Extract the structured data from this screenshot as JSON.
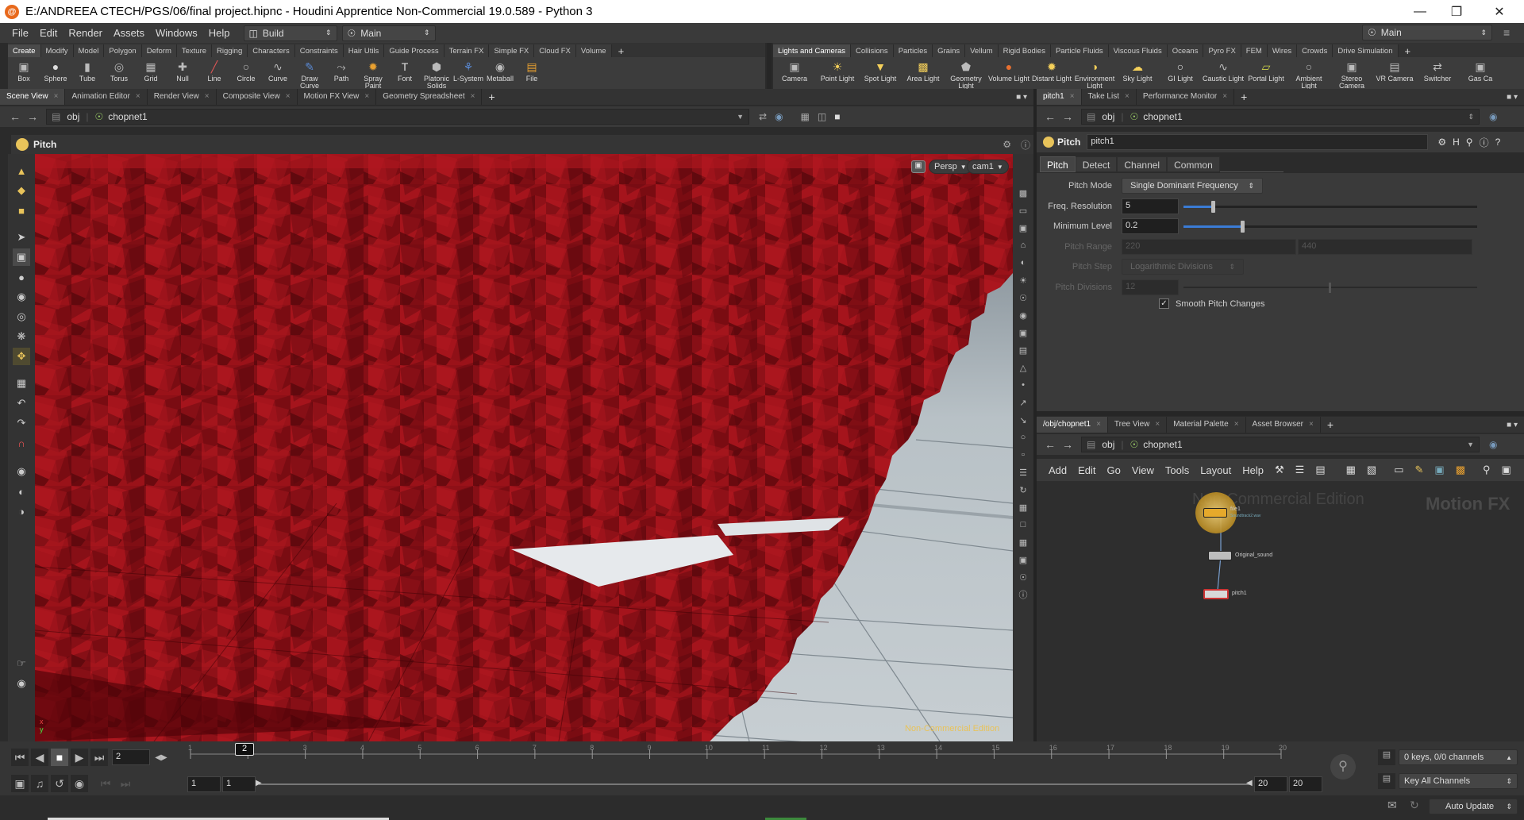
{
  "window": {
    "title": "E:/ANDREEA CTECH/PGS/06/final project.hipnc - Houdini Apprentice Non-Commercial 19.0.589 - Python 3"
  },
  "menu": [
    "File",
    "Edit",
    "Render",
    "Assets",
    "Windows",
    "Help"
  ],
  "desktop_left": "Build",
  "desktop_center": "Main",
  "desktop_right": "Main",
  "shelf_left": {
    "tabs": [
      "Create",
      "Modify",
      "Model",
      "Polygon",
      "Deform",
      "Texture",
      "Rigging",
      "Characters",
      "Constraints",
      "Hair Utils",
      "Guide Process",
      "Terrain FX",
      "Simple FX",
      "Cloud FX",
      "Volume"
    ],
    "tools": [
      {
        "label": "Box",
        "icon": "box-icon"
      },
      {
        "label": "Sphere",
        "icon": "sphere-icon"
      },
      {
        "label": "Tube",
        "icon": "tube-icon"
      },
      {
        "label": "Torus",
        "icon": "torus-icon"
      },
      {
        "label": "Grid",
        "icon": "grid-icon"
      },
      {
        "label": "Null",
        "icon": "null-icon"
      },
      {
        "label": "Line",
        "icon": "line-icon"
      },
      {
        "label": "Circle",
        "icon": "circle-icon"
      },
      {
        "label": "Curve",
        "icon": "curve-icon"
      },
      {
        "label": "Draw Curve",
        "icon": "draw-curve-icon"
      },
      {
        "label": "Path",
        "icon": "path-icon"
      },
      {
        "label": "Spray Paint",
        "icon": "spray-paint-icon"
      },
      {
        "label": "Font",
        "icon": "font-icon"
      },
      {
        "label": "Platonic Solids",
        "icon": "platonic-icon"
      },
      {
        "label": "L-System",
        "icon": "lsystem-icon"
      },
      {
        "label": "Metaball",
        "icon": "metaball-icon"
      },
      {
        "label": "File",
        "icon": "file-icon"
      }
    ]
  },
  "shelf_right": {
    "tabs": [
      "Lights and Cameras",
      "Collisions",
      "Particles",
      "Grains",
      "Vellum",
      "Rigid Bodies",
      "Particle Fluids",
      "Viscous Fluids",
      "Oceans",
      "Pyro FX",
      "FEM",
      "Wires",
      "Crowds",
      "Drive Simulation"
    ],
    "tools": [
      {
        "label": "Camera",
        "icon": "camera-icon"
      },
      {
        "label": "Point Light",
        "icon": "point-light-icon"
      },
      {
        "label": "Spot Light",
        "icon": "spot-light-icon"
      },
      {
        "label": "Area Light",
        "icon": "area-light-icon"
      },
      {
        "label": "Geometry Light",
        "icon": "geometry-light-icon"
      },
      {
        "label": "Volume Light",
        "icon": "volume-light-icon"
      },
      {
        "label": "Distant Light",
        "icon": "distant-light-icon"
      },
      {
        "label": "Environment Light",
        "icon": "environment-light-icon"
      },
      {
        "label": "Sky Light",
        "icon": "sky-light-icon"
      },
      {
        "label": "GI Light",
        "icon": "gi-light-icon"
      },
      {
        "label": "Caustic Light",
        "icon": "caustic-light-icon"
      },
      {
        "label": "Portal Light",
        "icon": "portal-light-icon"
      },
      {
        "label": "Ambient Light",
        "icon": "ambient-light-icon"
      },
      {
        "label": "Stereo Camera",
        "icon": "stereo-camera-icon"
      },
      {
        "label": "VR Camera",
        "icon": "vr-camera-icon"
      },
      {
        "label": "Switcher",
        "icon": "switcher-icon"
      },
      {
        "label": "Gas Ca",
        "icon": "gas-camera-icon"
      }
    ]
  },
  "left_pane": {
    "tabs": [
      "Scene View",
      "Animation Editor",
      "Render View",
      "Composite View",
      "Motion FX View",
      "Geometry Spreadsheet"
    ],
    "path_root": "obj",
    "path_node": "chopnet1",
    "node_label": "Pitch",
    "camera_menu": "Persp",
    "cam_menu": "cam1",
    "watermark": "Non-Commercial Edition"
  },
  "param_pane": {
    "tabs": [
      "pitch1",
      "Take List",
      "Performance Monitor"
    ],
    "path_root": "obj",
    "path_node": "chopnet1",
    "node_type": "Pitch",
    "node_name": "pitch1",
    "subtabs": [
      "Pitch",
      "Detect",
      "Channel",
      "Common"
    ],
    "parms": {
      "pitch_mode": {
        "label": "Pitch Mode",
        "value": "Single Dominant Frequency"
      },
      "freq_res": {
        "label": "Freq. Resolution",
        "value": "5",
        "slider": 0.1
      },
      "min_level": {
        "label": "Minimum Level",
        "value": "0.2",
        "slider": 0.2
      },
      "pitch_range": {
        "label": "Pitch Range",
        "v1": "220",
        "v2": "440"
      },
      "pitch_step": {
        "label": "Pitch Step",
        "value": "Logarithmic Divisions"
      },
      "pitch_div": {
        "label": "Pitch Divisions",
        "value": "12",
        "slider": 0.5
      },
      "smooth": {
        "label": "Smooth Pitch Changes",
        "checked": true
      }
    }
  },
  "net_pane": {
    "tabs": [
      "/obj/chopnet1",
      "Tree View",
      "Material Palette",
      "Asset Browser"
    ],
    "path_root": "obj",
    "path_node": "chopnet1",
    "menu": [
      "Add",
      "Edit",
      "Go",
      "View",
      "Tools",
      "Layout",
      "Help"
    ],
    "watermark": "Non-Commercial Edition",
    "context_label": "Motion FX",
    "nodes": [
      {
        "name": "file1",
        "sub": "Soundtrack2.wav"
      },
      {
        "name": "Original_sound",
        "sub": ""
      },
      {
        "name": "pitch1",
        "sub": ""
      }
    ]
  },
  "timeline": {
    "current_frame": "2",
    "ticks": [
      "1",
      "2",
      "3",
      "4",
      "5",
      "6",
      "7",
      "8",
      "9",
      "10",
      "11",
      "12",
      "13",
      "14",
      "15",
      "16",
      "17",
      "18",
      "19",
      "20"
    ],
    "start": "1",
    "range_start": "1",
    "range_end": "20",
    "end": "20",
    "keys_info": "0 keys, 0/0 channels",
    "key_channels": "Key All Channels",
    "update_mode": "Auto Update"
  },
  "colors": {
    "accent": "#e8c35a",
    "mesh": "#8b0f15",
    "bg": "#2b2b2b",
    "panel": "#3a3a3a"
  }
}
